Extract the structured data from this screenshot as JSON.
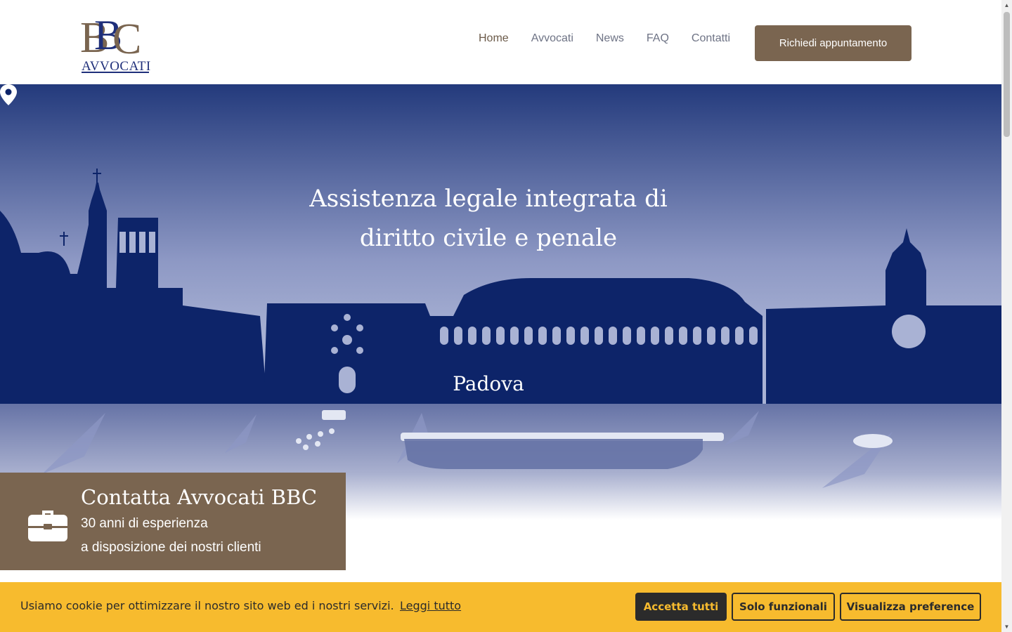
{
  "logo": {
    "text": "AVVOCATI",
    "monogram": "BBC",
    "colors": {
      "navy": "#1f2f7a",
      "brown": "#7a6550"
    }
  },
  "nav": {
    "items": [
      {
        "label": "Home",
        "active": true
      },
      {
        "label": "Avvocati",
        "active": false
      },
      {
        "label": "News",
        "active": false
      },
      {
        "label": "FAQ",
        "active": false
      },
      {
        "label": "Contatti",
        "active": false
      }
    ],
    "cta_label": "Richiedi appuntamento"
  },
  "hero": {
    "title_line1": "Assistenza legale integrata di",
    "title_line2": "diritto civile e penale",
    "city": "Padova",
    "icon": "map-pin-icon",
    "colors": {
      "sky_top": "#233a7c",
      "sky_bottom": "#9ba6cc",
      "skyline": "#0d2469",
      "reflection": "#6673a6"
    }
  },
  "contact": {
    "icon": "briefcase-icon",
    "title": "Contatta Avvocati BBC",
    "line1": "30 anni di esperienza",
    "line2": "a disposizione dei nostri clienti"
  },
  "cookie": {
    "text": "Usiamo cookie per ottimizzare il nostro sito web ed i nostri servizi.",
    "link": "Leggi tutto",
    "accept": "Accetta tutti",
    "functional": "Solo funzionali",
    "preferences": "Visualizza preference",
    "colors": {
      "bar": "#f7bb2e",
      "dark": "#2b2b2b"
    }
  }
}
